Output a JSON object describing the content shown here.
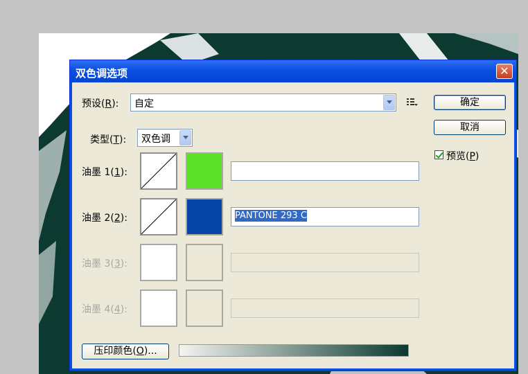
{
  "dialog": {
    "title": "双色调选项",
    "close_glyph": "✕"
  },
  "preset": {
    "label": "预设",
    "mnemonic": "R",
    "value": "自定"
  },
  "type": {
    "label": "类型",
    "mnemonic": "T",
    "value": "双色调"
  },
  "inks": [
    {
      "label": "油墨 1",
      "mnemonic": "1",
      "color": "#5ce02a",
      "name": "",
      "enabled": true
    },
    {
      "label": "油墨 2",
      "mnemonic": "2",
      "color": "#0645a8",
      "name": "PANTONE 293 C",
      "enabled": true
    },
    {
      "label": "油墨 3",
      "mnemonic": "3",
      "color": "",
      "name": "",
      "enabled": false
    },
    {
      "label": "油墨 4",
      "mnemonic": "4",
      "color": "",
      "name": "",
      "enabled": false
    }
  ],
  "buttons": {
    "ok": "确定",
    "cancel": "取消",
    "overprint_label": "压印颜色",
    "overprint_mnemonic": "O",
    "overprint_suffix": "..."
  },
  "preview": {
    "label": "预览",
    "mnemonic": "P",
    "checked": true
  },
  "gradient": {
    "from": "#f4f4f0",
    "to": "#0b3a2f"
  },
  "colors": {
    "canvas_ink": "#0c3a30"
  },
  "icons": {
    "preset_menu": "preset-menu-icon"
  }
}
